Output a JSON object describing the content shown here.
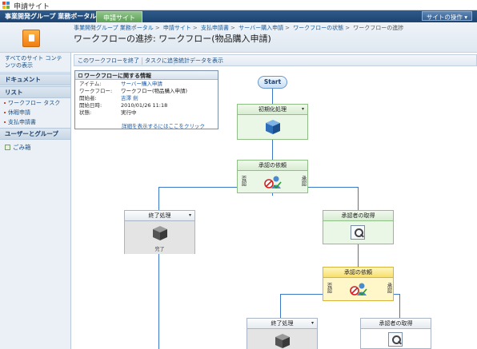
{
  "app": {
    "site_title": "申請サイト",
    "portal_name": "事業開発グループ 業務ポータル",
    "active_tab": "申請サイト",
    "site_actions": "サイトの操作 ▾"
  },
  "breadcrumb": {
    "items": [
      "事業開発グループ 業務ポータル",
      "申請サイト",
      "支払申請書",
      "サーバー購入申請",
      "ワークフローの状態"
    ],
    "current": "ワークフローの進捗"
  },
  "page_title": "ワークフローの進捗: ワークフロー(物品購入申請)",
  "leftnav": {
    "all_site": "すべてのサイト コンテンツの表示",
    "sections": [
      {
        "title": "ドキュメント",
        "items": []
      },
      {
        "title": "リスト",
        "items": [
          "ワークフロー タスク",
          "休暇申請",
          "支払申請書"
        ]
      },
      {
        "title": "ユーザーとグループ",
        "items": []
      }
    ],
    "recycle": "ごみ箱"
  },
  "toolbar": {
    "end_workflow": "このワークフローを終了",
    "reassign": "タスクに追答",
    "stats": "統計データを表示"
  },
  "infobox": {
    "title": "ワークフローに関する情報",
    "rows": [
      {
        "k": "アイテム:",
        "v": "サーバー購入申請"
      },
      {
        "k": "ワークフロー:",
        "v": "ワークフロー(物品購入申請)"
      },
      {
        "k": "開始者:",
        "v": "吉澤 劍"
      },
      {
        "k": "開始日時:",
        "v": "2010/01/26 11:18"
      },
      {
        "k": "状態:",
        "v": "実行中"
      }
    ],
    "detail_link": "詳細を表示するにはここをクリック"
  },
  "workflow": {
    "start": "Start",
    "node_init": "初期化処理",
    "node_approval_1": "承認の依頼",
    "node_end_1": "終了処理",
    "node_get_approver_1": "承認者の取得",
    "node_approval_2": "承認の依頼",
    "node_end_2": "終了処理",
    "node_get_approver_2": "承認者の取得",
    "left_label": "否認",
    "right_label": "承認",
    "end_sub": "完了"
  },
  "colors": {
    "nav_blue": "#1d4372",
    "tab_green": "#5c9f57",
    "connector": "#3c78c8",
    "node_green": "#eaf6e6",
    "node_yellow": "#fff7c9"
  }
}
